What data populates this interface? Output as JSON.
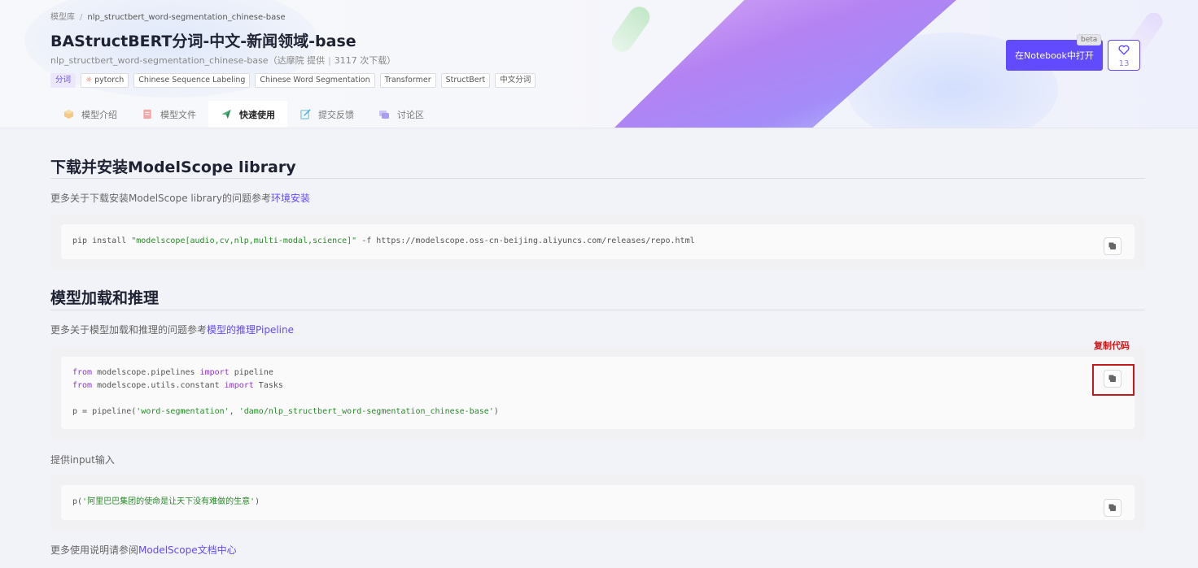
{
  "breadcrumb": {
    "root": "模型库",
    "separator": "/",
    "current": "nlp_structbert_word-segmentation_chinese-base"
  },
  "header": {
    "title": "BAStructBERT分词-中文-新闻领域-base",
    "model_id": "nlp_structbert_word-segmentation_chinese-base",
    "provider": "（达摩院 提供",
    "downloads": "3117 次下载）",
    "tags": [
      "分词",
      "pytorch",
      "Chinese Sequence Labeling",
      "Chinese Word Segmentation",
      "Transformer",
      "StructBert",
      "中文分词"
    ],
    "notebook_button": "在Notebook中打开",
    "beta": "beta",
    "like_count": "13"
  },
  "tabs": [
    {
      "label": "模型介绍",
      "icon": "cube-icon"
    },
    {
      "label": "模型文件",
      "icon": "file-icon"
    },
    {
      "label": "快速使用",
      "icon": "paper-plane-icon",
      "active": true
    },
    {
      "label": "提交反馈",
      "icon": "edit-icon"
    },
    {
      "label": "讨论区",
      "icon": "chat-icon"
    }
  ],
  "sections": {
    "install": {
      "title": "下载并安装ModelScope library",
      "desc": "更多关于下载安装ModelScope library的问题参考",
      "link": "环境安装",
      "code_cmd": "pip install ",
      "code_str": "\"modelscope[audio,cv,nlp,multi-modal,science]\"",
      "code_rest": " -f https://modelscope.oss-cn-beijing.aliyuncs.com/releases/repo.html"
    },
    "inference": {
      "title": "模型加载和推理",
      "desc": "更多关于模型加载和推理的问题参考",
      "link": "模型的推理Pipeline",
      "l1_from": "from",
      "l1_mod": " modelscope.pipelines ",
      "l1_import": "import",
      "l1_name": " pipeline",
      "l2_from": "from",
      "l2_mod": " modelscope.utils.constant ",
      "l2_import": "import",
      "l2_name": " Tasks",
      "l3_prefix": "p = pipeline(",
      "l3_arg1": "'word-segmentation'",
      "l3_comma": ", ",
      "l3_arg2": "'damo/nlp_structbert_word-segmentation_chinese-base'",
      "l3_suffix": ")",
      "copy_annotation": "复制代码"
    },
    "input": {
      "desc": "提供input输入",
      "code_prefix": "p(",
      "code_str": "'阿里巴巴集团的使命是让天下没有难做的生意'",
      "code_suffix": ")"
    },
    "footer": {
      "desc": "更多使用说明请参阅",
      "link": "ModelScope文档中心"
    }
  },
  "colors": {
    "accent": "#624aff",
    "annotation": "#c41a1a",
    "keyword": "#8a3ac8",
    "string": "#2b8a2b"
  }
}
